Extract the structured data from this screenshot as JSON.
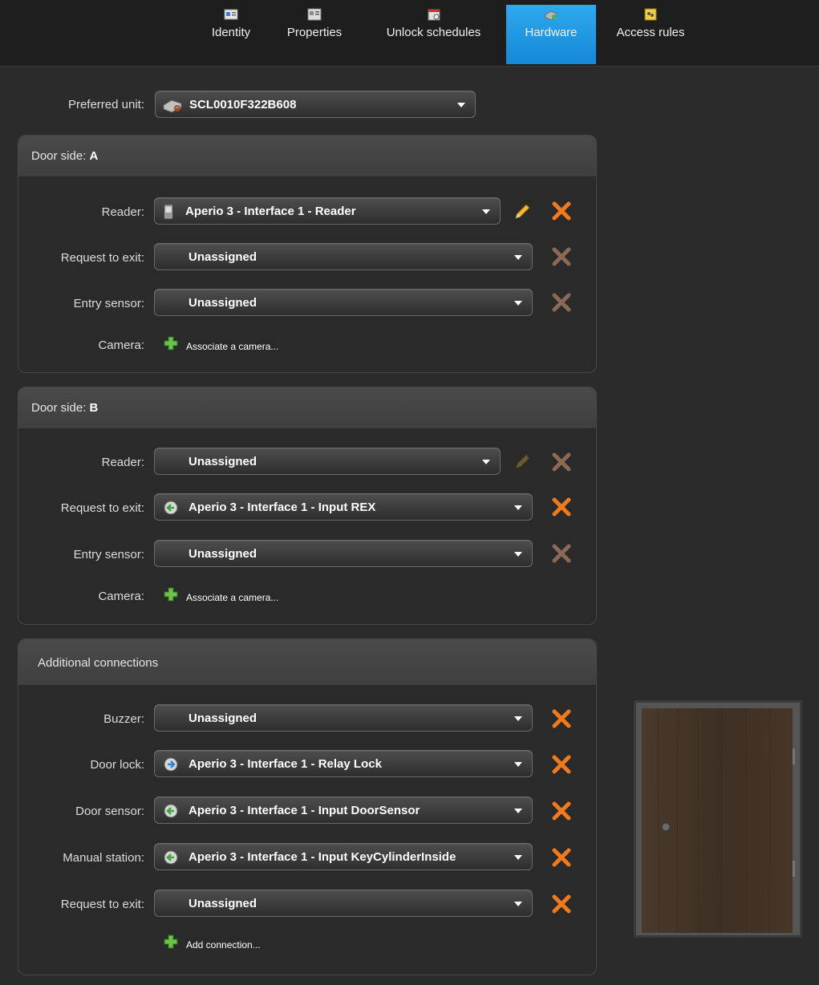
{
  "tabs": [
    {
      "label": "Identity",
      "icon": "identity-card-icon",
      "active": false
    },
    {
      "label": "Properties",
      "icon": "properties-icon",
      "active": false
    },
    {
      "label": "Unlock schedules",
      "icon": "calendar-icon",
      "active": false
    },
    {
      "label": "Hardware",
      "icon": "hardware-unit-icon",
      "active": true
    },
    {
      "label": "Access rules",
      "icon": "access-rules-icon",
      "active": false
    }
  ],
  "preferred_unit": {
    "label": "Preferred unit:",
    "value": "SCL0010F322B608"
  },
  "door_side_a": {
    "title_prefix": "Door side: ",
    "title_value": "A",
    "reader": {
      "label": "Reader:",
      "value": "Aperio 3 - Interface 1 - Reader"
    },
    "request_to_exit": {
      "label": "Request to exit:",
      "value": "Unassigned"
    },
    "entry_sensor": {
      "label": "Entry sensor:",
      "value": "Unassigned"
    },
    "camera": {
      "label": "Camera:",
      "link": "Associate a camera..."
    }
  },
  "door_side_b": {
    "title_prefix": "Door side: ",
    "title_value": "B",
    "reader": {
      "label": "Reader:",
      "value": "Unassigned"
    },
    "request_to_exit": {
      "label": "Request to exit:",
      "value": "Aperio 3 - Interface 1 - Input REX"
    },
    "entry_sensor": {
      "label": "Entry sensor:",
      "value": "Unassigned"
    },
    "camera": {
      "label": "Camera:",
      "link": "Associate a camera..."
    }
  },
  "additional": {
    "title": "Additional connections",
    "buzzer": {
      "label": "Buzzer:",
      "value": "Unassigned"
    },
    "door_lock": {
      "label": "Door lock:",
      "value": "Aperio 3 - Interface 1 - Relay Lock"
    },
    "door_sensor": {
      "label": "Door sensor:",
      "value": "Aperio 3 - Interface 1 - Input DoorSensor"
    },
    "manual_station": {
      "label": "Manual station:",
      "value": "Aperio 3 - Interface 1 - Input KeyCylinderInside"
    },
    "request_to_exit": {
      "label": "Request to exit:",
      "value": "Unassigned"
    },
    "add_connection": "Add connection..."
  },
  "colors": {
    "accent_tab": "#1a90dc",
    "remove_active": "#f07a1e",
    "remove_disabled": "#8a6a55",
    "plus_green": "#6cc24a"
  }
}
